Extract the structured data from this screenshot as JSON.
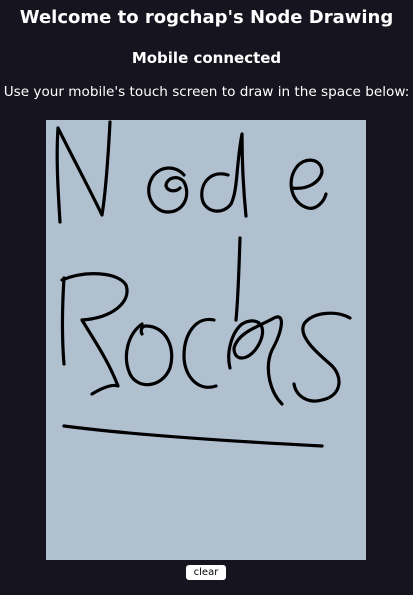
{
  "page": {
    "title": "Welcome to rogchap's Node Drawing",
    "status": "Mobile connected",
    "instructions": "Use your mobile's touch screen to draw in the space below:"
  },
  "canvas": {
    "background_color": "#b0c0cf",
    "stroke_color": "#000000"
  },
  "controls": {
    "clear_label": "clear"
  }
}
